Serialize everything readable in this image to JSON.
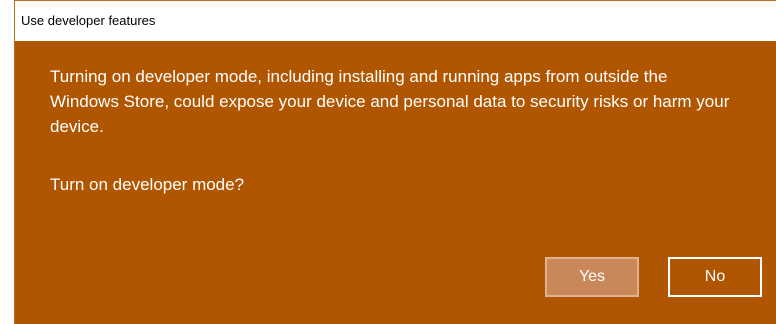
{
  "dialog": {
    "title": "Use developer features",
    "message": "Turning on developer mode, including installing and running apps from outside the Windows Store, could expose your device and personal data to security risks or harm your device.",
    "question": "Turn on developer mode?",
    "buttons": {
      "yes_label": "Yes",
      "no_label": "No"
    },
    "colors": {
      "accent": "#b05500",
      "yes_button": "#c9875a"
    }
  }
}
